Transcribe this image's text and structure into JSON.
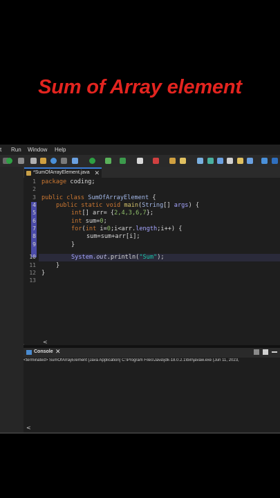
{
  "caption": "Sum of Array element",
  "menu": {
    "items": [
      "t",
      "Run",
      "Window",
      "Help"
    ]
  },
  "toolbar": {
    "icon_names": [
      "run-icon",
      "debug-icon",
      "save-icon",
      "search-icon",
      "settings-icon"
    ]
  },
  "editor_tab": {
    "label": "*SumOfArrayElement.java",
    "close": "✕"
  },
  "code_lines": {
    "n": [
      "1",
      "2",
      "3",
      "4",
      "5",
      "6",
      "7",
      "8",
      "9",
      "10",
      "11",
      "12",
      "13"
    ],
    "l1_kw": "package",
    "l1_rest": " coding;",
    "l3_kw1": "public",
    "l3_kw2": " class ",
    "l3_cls": "SumOfArrayElement",
    "l3_rest": " {",
    "l4_kw1": "public static void ",
    "l4_fn": "main",
    "l4_p1": "(",
    "l4_cls": "String",
    "l4_p2": "[] ",
    "l4_arg": "args",
    "l4_p3": ") {",
    "l5_kw": "int",
    "l5_a": "[] arr= {",
    "l5_n": "2,4,3,6,7",
    "l5_b": "};",
    "l6_kw": "int",
    "l6_a": " sum=",
    "l6_n": "0",
    "l6_b": ";",
    "l7_kw": "for",
    "l7_a": "(",
    "l7_kw2": "int",
    "l7_b": " i=",
    "l7_n": "0",
    "l7_c": ";i<arr.",
    "l7_fld": "length",
    "l7_d": ";i++) {",
    "l8": "sum=sum+arr[i];",
    "l9": "}",
    "l10_a": "System.",
    "l10_out": "out",
    "l10_b": ".println(",
    "l10_str": "\"Sum\"",
    "l10_c": ");",
    "l11": "}",
    "l12": "}"
  },
  "console": {
    "tab_label": "Console",
    "close": "✕",
    "status": "<terminated> SumOfArrayElement [Java Application] C:\\Program Files\\Java\\jdk-18.0.2.1\\bin\\javaw.exe  (Jun 11, 2023,",
    "scroll": "<"
  },
  "editor_scroll": "<"
}
